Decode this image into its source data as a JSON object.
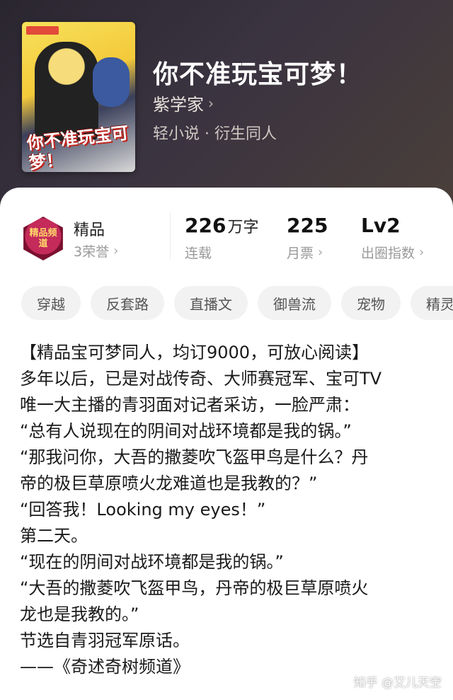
{
  "book": {
    "title": "你不准玩宝可梦！",
    "author": "紫学家",
    "genre": "轻小说 · 衍生同人",
    "cover_title": "你不准玩宝可梦！"
  },
  "stats": {
    "badge": {
      "label": "精品",
      "sub": "3荣誉",
      "medal_text": "精品频道"
    },
    "words": {
      "value": "226",
      "unit": "万字",
      "label": "连载"
    },
    "tickets": {
      "value": "225",
      "label": "月票"
    },
    "level": {
      "value": "Lv2",
      "label": "出圈指数"
    }
  },
  "tags": [
    "穿越",
    "反套路",
    "直播文",
    "御兽流",
    "宠物",
    "精灵"
  ],
  "description": [
    "【精品宝可梦同人，均订9000，可放心阅读】",
    "多年以后，已是对战传奇、大师赛冠军、宝可TV",
    "唯一大主播的青羽面对记者采访，一脸严肃：",
    "“总有人说现在的阴间对战环境都是我的锅。”",
    "“那我问你，大吾的撒菱吹飞盔甲鸟是什么？丹",
    "帝的极巨草原喷火龙难道也是我教的？”",
    "“回答我！Looking my eyes！”",
    "第二天。",
    "“现在的阴间对战环境都是我的锅。”",
    "“大吾的撒菱吹飞盔甲鸟，丹帝的极巨草原喷火",
    "龙也是我教的。”",
    "节选自青羽冠军原话。",
    "——《奇述奇树频道》"
  ],
  "watermark": "知乎 @艾儿天空",
  "colors": {
    "hero_bg": "#2f2a33",
    "tag_bg": "#f2f2f2",
    "medal": "#c42a5a"
  },
  "icons": {
    "chevron": "chevron-right-icon"
  }
}
